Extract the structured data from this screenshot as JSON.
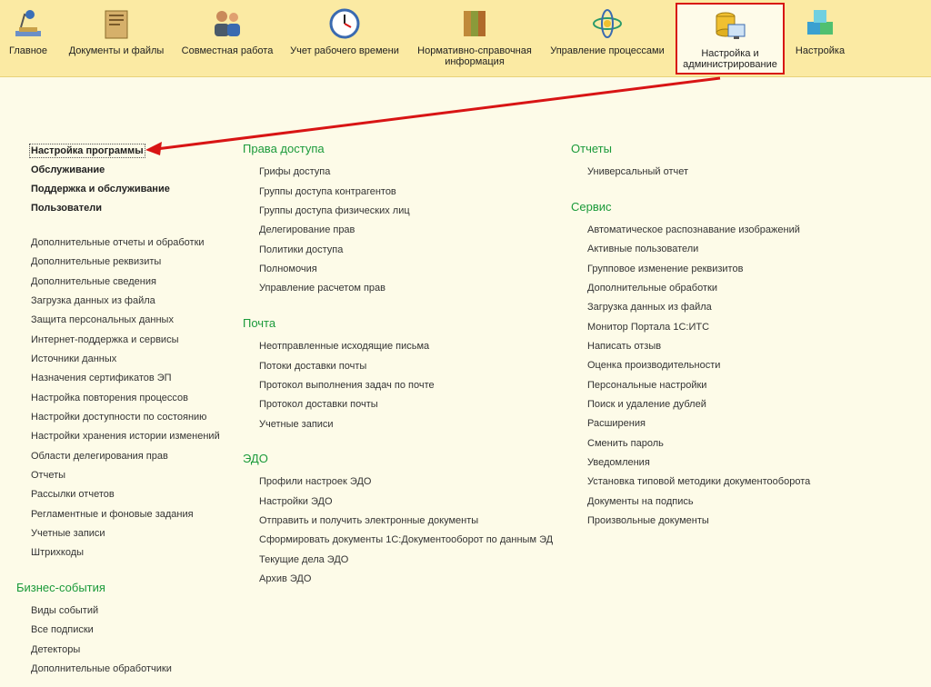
{
  "sections": [
    {
      "label": "Главное",
      "icon": "desk-lamp-icon"
    },
    {
      "label": "Документы и файлы",
      "icon": "document-folder-icon"
    },
    {
      "label": "Совместная работа",
      "icon": "people-icon"
    },
    {
      "label": "Учет рабочего времени",
      "icon": "clock-icon"
    },
    {
      "label": "Нормативно-справочная\nинформация",
      "icon": "binders-icon"
    },
    {
      "label": "Управление процессами",
      "icon": "process-icon"
    },
    {
      "label": "Настройка и\nадминистрирование",
      "icon": "database-computer-icon"
    },
    {
      "label": "Настройка",
      "icon": "cubes-icon"
    }
  ],
  "left": {
    "main_items": [
      "Настройка программы",
      "Обслуживание",
      "Поддержка и обслуживание",
      "Пользователи"
    ],
    "other_items": [
      "Дополнительные отчеты и обработки",
      "Дополнительные реквизиты",
      "Дополнительные сведения",
      "Загрузка данных из файла",
      "Защита персональных данных",
      "Интернет-поддержка и сервисы",
      "Источники данных",
      "Назначения сертификатов ЭП",
      "Настройка повторения процессов",
      "Настройки доступности по состоянию",
      "Настройки хранения истории изменений",
      "Области делегирования прав",
      "Отчеты",
      "Рассылки отчетов",
      "Регламентные и фоновые задания",
      "Учетные записи",
      "Штрихкоды"
    ],
    "business": {
      "title": "Бизнес-события",
      "items": [
        "Виды событий",
        "Все подписки",
        "Детекторы",
        "Дополнительные обработчики"
      ]
    }
  },
  "middle": [
    {
      "title": "Права доступа",
      "items": [
        "Грифы доступа",
        "Группы доступа контрагентов",
        "Группы доступа физических лиц",
        "Делегирование прав",
        "Политики доступа",
        "Полномочия",
        "Управление расчетом прав"
      ]
    },
    {
      "title": "Почта",
      "items": [
        "Неотправленные исходящие письма",
        "Потоки доставки почты",
        "Протокол выполнения задач по почте",
        "Протокол доставки почты",
        "Учетные записи"
      ]
    },
    {
      "title": "ЭДО",
      "items": [
        "Профили настроек ЭДО",
        "Настройки ЭДО",
        "Отправить и получить электронные документы",
        "Сформировать документы 1С:Документооборот по данным ЭД",
        "Текущие дела ЭДО",
        "Архив ЭДО"
      ]
    }
  ],
  "right": [
    {
      "title": "Отчеты",
      "items": [
        "Универсальный отчет"
      ]
    },
    {
      "title": "Сервис",
      "items": [
        "Автоматическое распознавание изображений",
        "Активные пользователи",
        "Групповое изменение реквизитов",
        "Дополнительные обработки",
        "Загрузка данных из файла",
        "Монитор Портала 1С:ИТС",
        "Написать отзыв",
        "Оценка производительности",
        "Персональные настройки",
        "Поиск и удаление дублей",
        "Расширения",
        "Сменить пароль",
        "Уведомления",
        "Установка типовой методики документооборота",
        "Документы на подпись",
        "Произвольные документы"
      ]
    }
  ],
  "colors": {
    "accent_red": "#d81414",
    "group_green": "#1a9a3a",
    "topbar": "#fbeaa3"
  }
}
